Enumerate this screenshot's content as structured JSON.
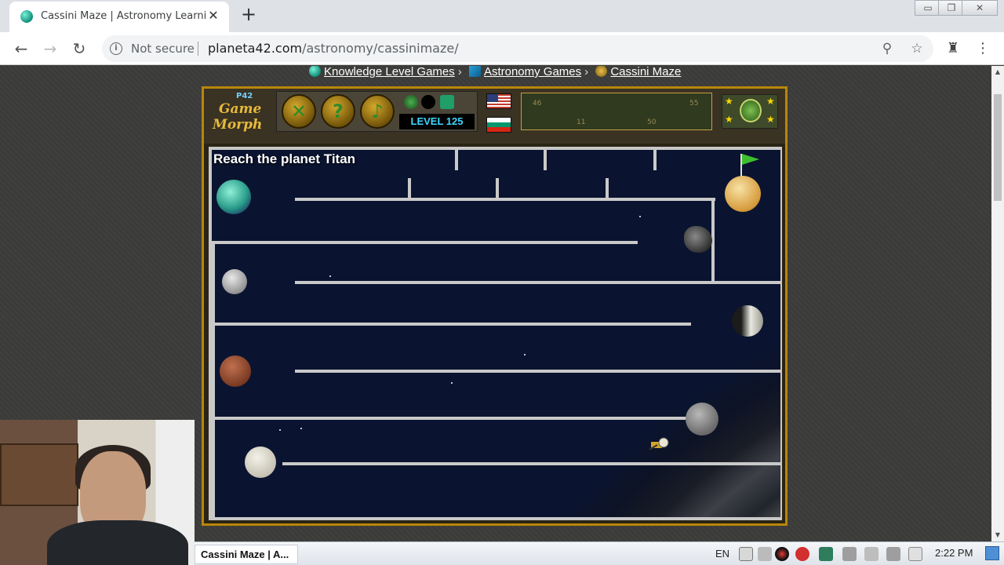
{
  "browser": {
    "tab_title": "Cassini Maze | Astronomy Learning",
    "tab_close": "✕",
    "new_tab": "+",
    "security_label": "Not secure",
    "url_host": "planeta42.com",
    "url_path": "/astronomy/cassinimaze/"
  },
  "breadcrumb": {
    "items": [
      "Knowledge Level Games",
      "Astronomy Games",
      "Cassini Maze"
    ],
    "separator": "›"
  },
  "game": {
    "logo_badge": "P42",
    "logo_line1": "Game",
    "logo_line2": "Morph",
    "level_label": "LEVEL 125",
    "stat_1": "46",
    "stat_2": "55",
    "stat_3": "11",
    "stat_4": "50",
    "maze_title": "Reach the planet Titan"
  },
  "taskbar": {
    "task_label": "Cassini Maze | A...",
    "language": "EN",
    "clock": "2:22 PM"
  },
  "colors": {
    "frame_gold": "#b8860b",
    "level_text": "#3fd6ff",
    "goal_flag": "#3fbf2f"
  }
}
